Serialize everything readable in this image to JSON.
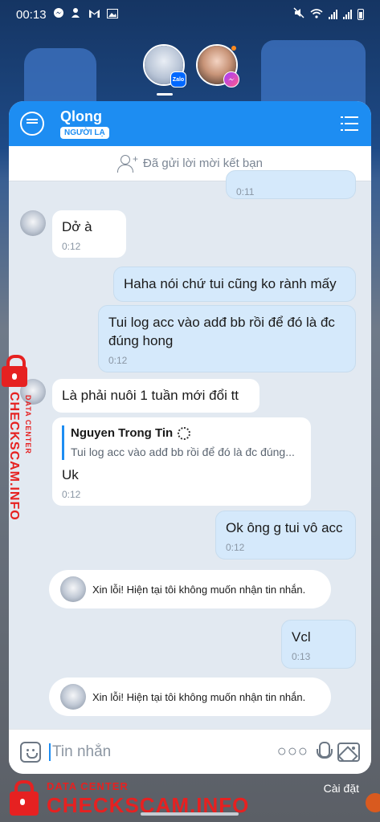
{
  "status_bar": {
    "time": "00:13"
  },
  "chat_heads": [
    {
      "app_badge": "Zalo"
    },
    {
      "app_badge": ""
    }
  ],
  "header": {
    "name": "Qlong",
    "badge": "NGƯỜI LẠ"
  },
  "friend_bar": {
    "text": "Đã gửi lời mời kết bạn"
  },
  "messages": [
    {
      "direction": "out",
      "text": "",
      "time": "0:11"
    },
    {
      "direction": "in",
      "text": "Dở à",
      "time": "0:12"
    },
    {
      "direction": "out",
      "text": "Haha nói chứ tui cũng ko rành mấy",
      "time": ""
    },
    {
      "direction": "out",
      "text": "Tui log acc vào adđ bb rồi để đó là đc đúng hong",
      "time": "0:12"
    },
    {
      "direction": "in",
      "text": "Là phải nuôi 1 tuần mới đổi tt",
      "time": ""
    },
    {
      "direction": "in",
      "quote_name": "Nguyen Trong Tin",
      "quote_text": "Tui log acc vào adđ bb rồi để đó là đc đúng...",
      "text": "Uk",
      "time": "0:12"
    },
    {
      "direction": "out",
      "text": "Ok ông g tui vô acc",
      "time": "0:12"
    },
    {
      "direction": "system",
      "text": "Xin lỗi! Hiện tại tôi không muốn nhận tin nhắn."
    },
    {
      "direction": "out",
      "text": "Vcl",
      "time": "0:13"
    },
    {
      "direction": "system",
      "text": "Xin lỗi! Hiện tại tôi không muốn nhận tin nhắn."
    }
  ],
  "input": {
    "placeholder": "Tin nhắn"
  },
  "settings_label": "Cài đặt",
  "watermark": {
    "small": "DATA CENTER",
    "big": "CHECKSCAM.INFO"
  },
  "colors": {
    "accent": "#1d8df2",
    "outgoing_bubble": "#d5e9fb",
    "watermark": "#e62121"
  }
}
